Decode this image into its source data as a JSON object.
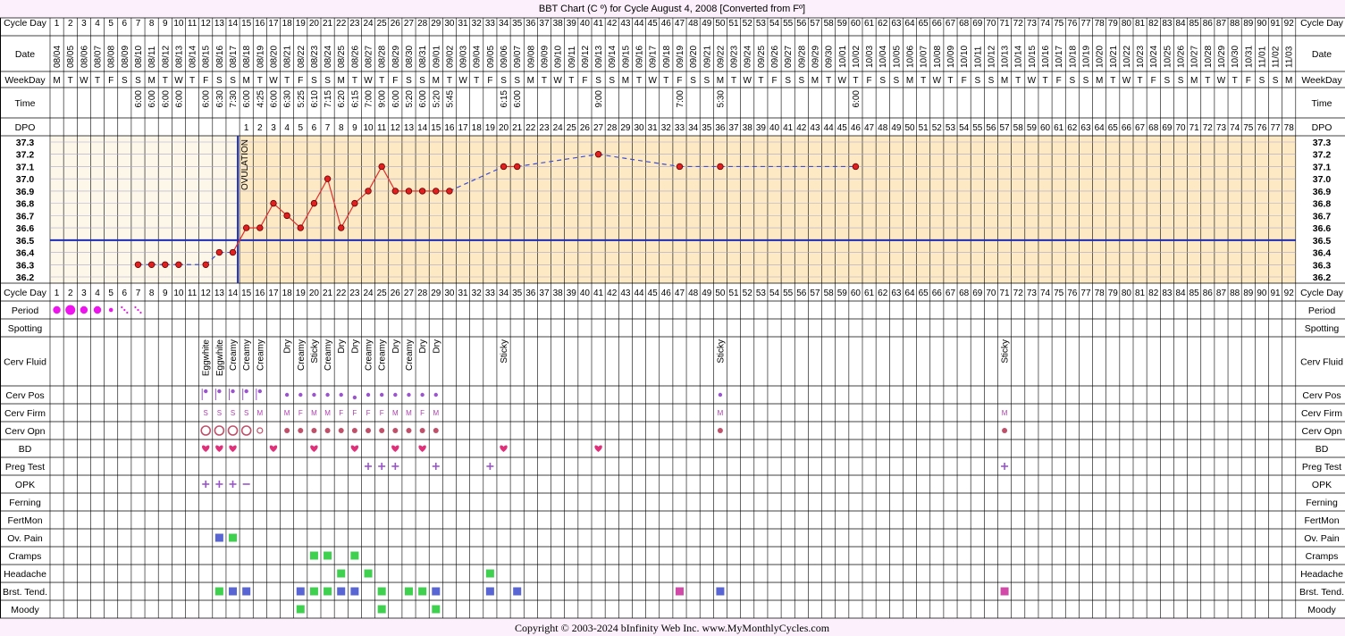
{
  "title": "BBT Chart (C º) for Cycle August 4, 2008  [Converted from Fº]",
  "copyright": "Copyright © 2003-2024 bInfinity Web Inc.     www.MyMonthlyCycles.com",
  "colors": {
    "page_bg": "#fbf0fb",
    "pre_ovulation_bg": "#fdf7ea",
    "post_ovulation_bg": "#fde9c4",
    "grid": "#a8a8c8",
    "coverline": "#1c2db4",
    "temp_line": "#e03030",
    "temp_dashed": "#3f4fd0",
    "point_fill": "#e02020",
    "period": "#ee14ee",
    "symptom_purple": "#9a55cc",
    "firm_text": "#b040b0",
    "opening": "#c0506a",
    "heart": "#e0307a",
    "green": "#3fd04f",
    "blue": "#5865d2",
    "magenta": "#d24aa8"
  },
  "row_labels": {
    "cycle_day": "Cycle Day",
    "date": "Date",
    "weekday": "WeekDay",
    "time": "Time",
    "dpo": "DPO",
    "period": "Period",
    "spotting": "Spotting",
    "cerv_fluid": "Cerv Fluid",
    "cerv_pos": "Cerv Pos",
    "cerv_firm": "Cerv Firm",
    "cerv_opn": "Cerv Opn",
    "bd": "BD",
    "preg_test": "Preg Test",
    "opk": "OPK",
    "ferning": "Ferning",
    "fertmon": "FertMon",
    "ov_pain": "Ov. Pain",
    "cramps": "Cramps",
    "headache": "Headache",
    "brst_tend": "Brst. Tend.",
    "moody": "Moody"
  },
  "chart_data": {
    "type": "line",
    "title": "BBT Chart (C º) for Cycle August 4, 2008  [Converted from Fº]",
    "xlabel": "Cycle Day",
    "ylabel": "",
    "days": [
      1,
      2,
      3,
      4,
      5,
      6,
      7,
      8,
      9,
      10,
      11,
      12,
      13,
      14,
      15,
      16,
      17,
      18,
      19,
      20,
      21,
      22,
      23,
      24,
      25,
      26,
      27,
      28,
      29,
      30,
      31,
      32,
      33,
      34,
      35,
      36,
      37,
      38,
      39,
      40,
      41,
      42,
      43,
      44,
      45,
      46,
      47,
      48,
      49,
      50,
      51,
      52,
      53,
      54,
      55,
      56,
      57,
      58,
      59,
      60,
      61,
      62,
      63,
      64,
      65,
      66,
      67,
      68,
      69,
      70,
      71,
      72,
      73,
      74,
      75,
      76,
      77,
      78,
      79,
      80,
      81,
      82,
      83,
      84,
      85,
      86,
      87,
      88,
      89,
      90,
      91,
      92
    ],
    "dates": [
      "08/04",
      "08/05",
      "08/06",
      "08/07",
      "08/08",
      "08/09",
      "08/10",
      "08/11",
      "08/12",
      "08/13",
      "08/14",
      "08/15",
      "08/16",
      "08/17",
      "08/18",
      "08/19",
      "08/20",
      "08/21",
      "08/22",
      "08/23",
      "08/24",
      "08/25",
      "08/26",
      "08/27",
      "08/28",
      "08/29",
      "08/30",
      "08/31",
      "09/01",
      "09/02",
      "09/03",
      "09/04",
      "09/05",
      "09/06",
      "09/07",
      "09/08",
      "09/09",
      "09/10",
      "09/11",
      "09/12",
      "09/13",
      "09/14",
      "09/15",
      "09/16",
      "09/17",
      "09/18",
      "09/19",
      "09/20",
      "09/21",
      "09/22",
      "09/23",
      "09/24",
      "09/25",
      "09/26",
      "09/27",
      "09/28",
      "09/29",
      "09/30",
      "10/01",
      "10/02",
      "10/03",
      "10/04",
      "10/05",
      "10/06",
      "10/07",
      "10/08",
      "10/09",
      "10/10",
      "10/11",
      "10/12",
      "10/13",
      "10/14",
      "10/15",
      "10/16",
      "10/17",
      "10/18",
      "10/19",
      "10/20",
      "10/21",
      "10/22",
      "10/23",
      "10/24",
      "10/25",
      "10/26",
      "10/27",
      "10/28",
      "10/29",
      "10/30",
      "10/31",
      "11/01",
      "11/02",
      "11/03"
    ],
    "weekdays": [
      "M",
      "T",
      "W",
      "T",
      "F",
      "S",
      "S",
      "M",
      "T",
      "W",
      "T",
      "F",
      "S",
      "S",
      "M",
      "T",
      "W",
      "T",
      "F",
      "S",
      "S",
      "M",
      "T",
      "W",
      "T",
      "F",
      "S",
      "S",
      "M",
      "T",
      "W",
      "T",
      "F",
      "S",
      "S",
      "M",
      "T",
      "W",
      "T",
      "F",
      "S",
      "S",
      "M",
      "T",
      "W",
      "T",
      "F",
      "S",
      "S",
      "M",
      "T",
      "W",
      "T",
      "F",
      "S",
      "S",
      "M",
      "T",
      "W",
      "T",
      "F",
      "S",
      "S",
      "M",
      "T",
      "W",
      "T",
      "F",
      "S",
      "S",
      "M",
      "T",
      "W",
      "T",
      "F",
      "S",
      "S",
      "M",
      "T",
      "W",
      "T",
      "F",
      "S",
      "S",
      "M",
      "T",
      "W",
      "T",
      "F",
      "S",
      "S",
      "M"
    ],
    "times": {
      "7": "6:00",
      "8": "6:00",
      "9": "6:00",
      "10": "6:00",
      "12": "6:00",
      "13": "6:30",
      "14": "7:30",
      "15": "6:00",
      "16": "4:25",
      "17": "6:00",
      "18": "6:30",
      "19": "5:25",
      "20": "6:10",
      "21": "7:15",
      "22": "6:20",
      "23": "6:15",
      "24": "7:00",
      "25": "9:00",
      "26": "6:00",
      "27": "5:20",
      "28": "6:00",
      "29": "5:20",
      "30": "5:45",
      "34": "6:15",
      "35": "6:00",
      "41": "9:00",
      "47": "7:00",
      "50": "5:30",
      "60": "6:00"
    },
    "dpo_start_day": 15,
    "ovulation_day": 14,
    "ovulation_label": "OVULATION",
    "coverline": 36.5,
    "ylim": [
      36.2,
      37.3
    ],
    "y_ticks": [
      "37.3",
      "37.2",
      "37.1",
      "37.0",
      "36.9",
      "36.8",
      "36.7",
      "36.6",
      "36.5",
      "36.4",
      "36.3",
      "36.2"
    ],
    "points": [
      {
        "day": 7,
        "temp": 36.3
      },
      {
        "day": 8,
        "temp": 36.3
      },
      {
        "day": 9,
        "temp": 36.3
      },
      {
        "day": 10,
        "temp": 36.3
      },
      {
        "day": 12,
        "temp": 36.3
      },
      {
        "day": 13,
        "temp": 36.4
      },
      {
        "day": 14,
        "temp": 36.4
      },
      {
        "day": 15,
        "temp": 36.6
      },
      {
        "day": 16,
        "temp": 36.6
      },
      {
        "day": 17,
        "temp": 36.8
      },
      {
        "day": 18,
        "temp": 36.7
      },
      {
        "day": 19,
        "temp": 36.6
      },
      {
        "day": 20,
        "temp": 36.8
      },
      {
        "day": 21,
        "temp": 37.0
      },
      {
        "day": 22,
        "temp": 36.6
      },
      {
        "day": 23,
        "temp": 36.8
      },
      {
        "day": 24,
        "temp": 36.9
      },
      {
        "day": 25,
        "temp": 37.1
      },
      {
        "day": 26,
        "temp": 36.9
      },
      {
        "day": 27,
        "temp": 36.9
      },
      {
        "day": 28,
        "temp": 36.9
      },
      {
        "day": 29,
        "temp": 36.9
      },
      {
        "day": 30,
        "temp": 36.9
      },
      {
        "day": 34,
        "temp": 37.1
      },
      {
        "day": 35,
        "temp": 37.1
      },
      {
        "day": 41,
        "temp": 37.2
      },
      {
        "day": 47,
        "temp": 37.1
      },
      {
        "day": 50,
        "temp": 37.1
      },
      {
        "day": 60,
        "temp": 37.1
      }
    ],
    "dashed_segments": [
      [
        10,
        12
      ],
      [
        30,
        34
      ],
      [
        35,
        41
      ],
      [
        41,
        47
      ],
      [
        47,
        50
      ],
      [
        50,
        60
      ]
    ],
    "period": [
      {
        "day": 1,
        "level": "medium"
      },
      {
        "day": 2,
        "level": "heavy"
      },
      {
        "day": 3,
        "level": "medium"
      },
      {
        "day": 4,
        "level": "medium"
      },
      {
        "day": 5,
        "level": "light"
      },
      {
        "day": 6,
        "level": "spotting"
      },
      {
        "day": 7,
        "level": "spotting"
      }
    ],
    "cerv_fluid": {
      "12": "Eggwhite",
      "13": "Eggwhite",
      "14": "Creamy",
      "15": "Creamy",
      "16": "Creamy",
      "18": "Dry",
      "19": "Creamy",
      "20": "Sticky",
      "21": "Creamy",
      "22": "Dry",
      "23": "Dry",
      "24": "Creamy",
      "25": "Creamy",
      "26": "Dry",
      "27": "Creamy",
      "28": "Dry",
      "29": "Dry",
      "34": "Sticky",
      "50": "Sticky",
      "71": "Sticky"
    },
    "cerv_pos": {
      "12": "high",
      "13": "high",
      "14": "high",
      "15": "high",
      "16": "high",
      "18": "mid",
      "19": "mid",
      "20": "mid",
      "21": "mid",
      "22": "mid",
      "23": "low",
      "24": "mid",
      "25": "mid",
      "26": "mid",
      "27": "mid",
      "28": "mid",
      "29": "mid",
      "50": "mid"
    },
    "cerv_firm": {
      "12": "S",
      "13": "S",
      "14": "S",
      "15": "S",
      "16": "M",
      "18": "M",
      "19": "F",
      "20": "M",
      "21": "M",
      "22": "F",
      "23": "F",
      "24": "F",
      "25": "F",
      "26": "M",
      "27": "M",
      "28": "F",
      "29": "M",
      "50": "M",
      "71": "M"
    },
    "cerv_opn": {
      "12": "open",
      "13": "open",
      "14": "open",
      "15": "open",
      "16": "medium",
      "18": "closed",
      "19": "closed",
      "20": "closed",
      "21": "closed",
      "22": "closed",
      "23": "closed",
      "24": "closed",
      "25": "closed",
      "26": "closed",
      "27": "closed",
      "28": "closed",
      "29": "closed",
      "50": "closed",
      "71": "closed"
    },
    "bd": [
      12,
      13,
      14,
      17,
      20,
      23,
      26,
      28,
      34,
      41
    ],
    "preg_test": [
      24,
      25,
      26,
      29,
      33,
      71
    ],
    "opk": {
      "12": "+",
      "13": "+",
      "14": "+",
      "15": "-"
    },
    "ov_pain": {
      "13": "blue",
      "14": "green"
    },
    "cramps": {
      "20": "green",
      "21": "green",
      "23": "green"
    },
    "headache": {
      "22": "green",
      "24": "green",
      "33": "green"
    },
    "brst_tend": {
      "13": "green",
      "14": "blue",
      "15": "blue",
      "19": "blue",
      "20": "green",
      "21": "green",
      "22": "blue",
      "23": "blue",
      "25": "green",
      "27": "green",
      "28": "green",
      "29": "blue",
      "33": "blue",
      "35": "blue",
      "47": "magenta",
      "50": "blue",
      "71": "magenta"
    },
    "moody": {
      "19": "green",
      "25": "green",
      "29": "green"
    }
  }
}
